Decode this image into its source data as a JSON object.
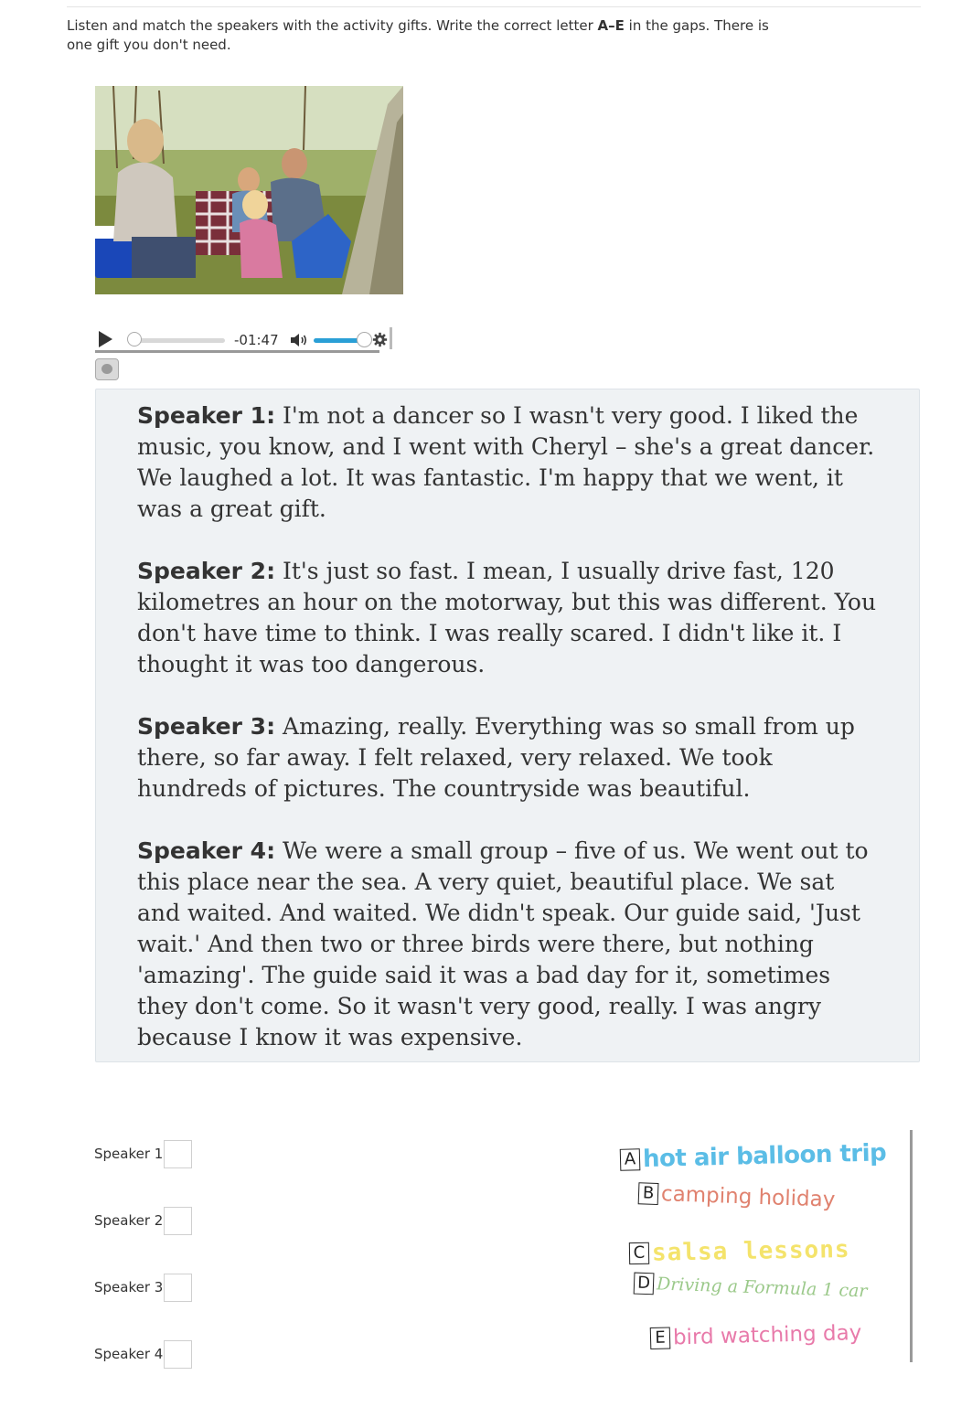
{
  "instructions": {
    "before": "Listen and match the speakers with the activity gifts. Write the correct letter ",
    "bold": "A–E",
    "after": " in the gaps. There is one gift you don't need."
  },
  "player": {
    "time": "-01:47",
    "progress": 0.0,
    "volume": 0.9
  },
  "transcript": [
    {
      "speaker": "Speaker 1:",
      "text": " I'm not a dancer so I wasn't very good. I liked the music, you know, and I went with Cheryl – she's a great dancer. We laughed a lot. It was fantastic. I'm happy that we went, it was a great gift."
    },
    {
      "speaker": "Speaker 2:",
      "text": " It's just so fast. I mean, I usually drive fast, 120 kilometres an hour on the motorway, but this was different. You don't have time to think. I was really scared. I didn't like it. I thought it was too dangerous."
    },
    {
      "speaker": "Speaker 3:",
      "text": " Amazing, really. Everything was so small from up there, so far away. I felt relaxed, very relaxed. We took hundreds of pictures. The countryside was beautiful."
    },
    {
      "speaker": "Speaker 4:",
      "text": " We were a small group – five of us. We went out to this place near the sea. A very quiet, beautiful place. We sat and waited. And waited. We didn't speak. Our guide said, 'Just wait.' And then two or three birds were there, but nothing 'amazing'. The guide said it was a bad day for it, sometimes they don't come. So it wasn't very good, really. I was angry because I know it was expensive."
    }
  ],
  "answers": [
    {
      "label": "Speaker 1",
      "value": ""
    },
    {
      "label": "Speaker 2",
      "value": ""
    },
    {
      "label": "Speaker 3",
      "value": ""
    },
    {
      "label": "Speaker 4",
      "value": ""
    }
  ],
  "gifts": [
    {
      "letter": "A",
      "name": "hot air balloon trip",
      "color": "#5bbde6"
    },
    {
      "letter": "B",
      "name": "camping holiday",
      "color": "#e0826f"
    },
    {
      "letter": "C",
      "name": "salsa lessons",
      "color": "#f4e36b"
    },
    {
      "letter": "D",
      "name": "Driving a Formula 1 car",
      "color": "#9bc98a"
    },
    {
      "letter": "E",
      "name": "bird watching day",
      "color": "#e87aaa"
    }
  ]
}
